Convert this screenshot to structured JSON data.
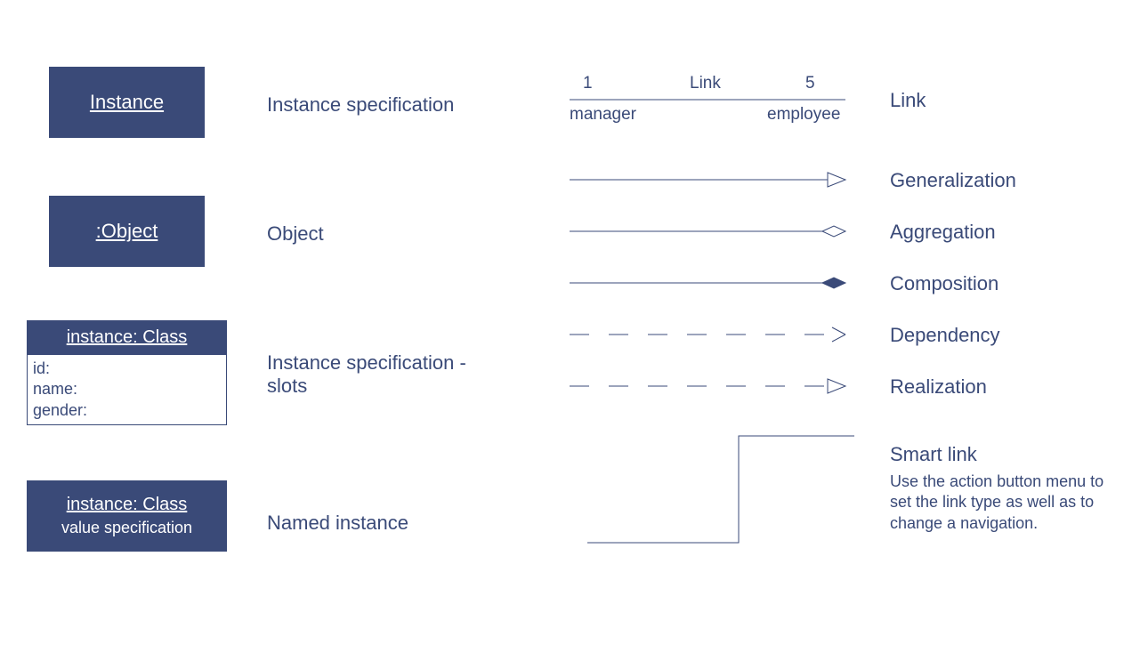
{
  "left": {
    "instance": {
      "title": "Instance",
      "label": "Instance specification"
    },
    "object": {
      "title": ":Object",
      "label": "Object"
    },
    "slots": {
      "title": "instance: Class",
      "slot1": "id:",
      "slot2": "name:",
      "slot3": "gender:",
      "label": "Instance specification - slots"
    },
    "named": {
      "title": "instance: Class",
      "value": "value specification",
      "label": "Named instance"
    }
  },
  "link": {
    "leftMult": "1",
    "name": "Link",
    "rightMult": "5",
    "leftRole": "manager",
    "rightRole": "employee",
    "label": "Link"
  },
  "arrows": {
    "generalization": "Generalization",
    "aggregation": "Aggregation",
    "composition": "Composition",
    "dependency": "Dependency",
    "realization": "Realization"
  },
  "smart": {
    "title": "Smart link",
    "desc": "Use the action button menu to set the link type as well as to change a navigation."
  }
}
